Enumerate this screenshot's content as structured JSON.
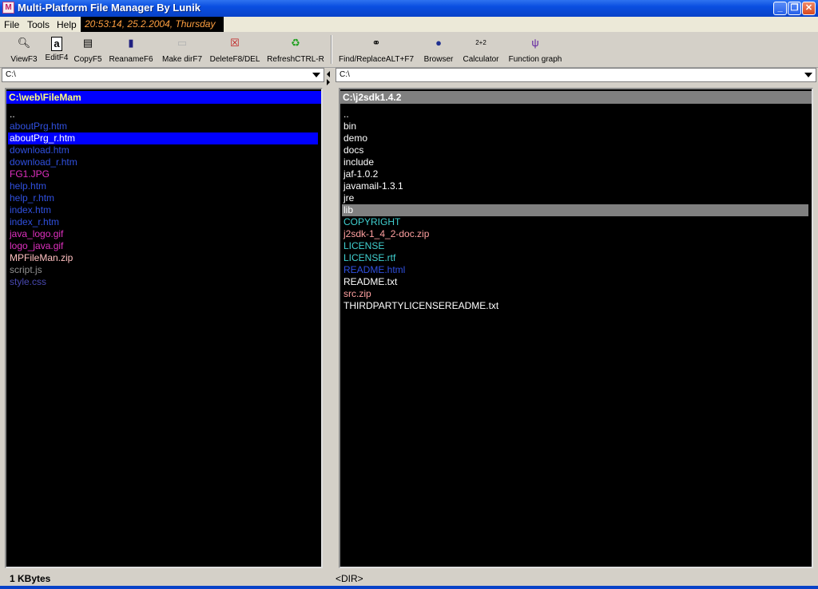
{
  "window": {
    "title": "Multi-Platform File Manager By Lunik"
  },
  "menu": {
    "file": "File",
    "tools": "Tools",
    "help": "Help"
  },
  "clock": "20:53:14, 25.2.2004, Thursday",
  "toolbar": [
    {
      "label": "ViewF3",
      "icon": "magnifier-icon"
    },
    {
      "label": "EditF4",
      "icon": "edit-icon"
    },
    {
      "label": "CopyF5",
      "icon": "copy-icon"
    },
    {
      "label": "ReanameF6",
      "icon": "rename-icon"
    },
    {
      "label": "Make dirF7",
      "icon": "folder-icon"
    },
    {
      "label": "DeleteF8/DEL",
      "icon": "delete-icon"
    },
    {
      "label": "RefreshCTRL-R",
      "icon": "refresh-icon"
    },
    {
      "label": "Find/ReplaceALT+F7",
      "icon": "binoculars-icon"
    },
    {
      "label": "Browser",
      "icon": "globe-icon"
    },
    {
      "label": "Calculator",
      "icon": "calculator-icon",
      "icon_text": "2+2"
    },
    {
      "label": "Function graph",
      "icon": "graph-icon"
    }
  ],
  "colors": {
    "dir": "#ffffff",
    "htm": "#3050e0",
    "image": "#e030c0",
    "zip": "#ffa0a0",
    "script": "#909090",
    "css": "#4040a0",
    "text_file": "#40d0d0",
    "selected_active": "#0000ff",
    "selected_inactive": "#808080"
  },
  "left": {
    "drive": "C:\\",
    "path": "C:\\web\\FileMam",
    "status": "1 KBytes",
    "files": [
      {
        "name": "..",
        "color": "#ffffff"
      },
      {
        "name": "aboutPrg.htm",
        "color": "#3050e0"
      },
      {
        "name": "aboutPrg_r.htm",
        "color": "#ffffff",
        "selected": true
      },
      {
        "name": "download.htm",
        "color": "#3050e0"
      },
      {
        "name": "download_r.htm",
        "color": "#3050e0"
      },
      {
        "name": "FG1.JPG",
        "color": "#e030c0"
      },
      {
        "name": "help.htm",
        "color": "#3050e0"
      },
      {
        "name": "help_r.htm",
        "color": "#3050e0"
      },
      {
        "name": "index.htm",
        "color": "#3050e0"
      },
      {
        "name": "index_r.htm",
        "color": "#3050e0"
      },
      {
        "name": "java_logo.gif",
        "color": "#e030c0"
      },
      {
        "name": "logo_java.gif",
        "color": "#e030c0"
      },
      {
        "name": "MPFileMan.zip",
        "color": "#ffc0c0"
      },
      {
        "name": "script.js",
        "color": "#909090"
      },
      {
        "name": "style.css",
        "color": "#4848b0"
      }
    ]
  },
  "right": {
    "drive": "C:\\",
    "path": "C:\\j2sdk1.4.2",
    "status": "<DIR>",
    "files": [
      {
        "name": "..",
        "color": "#ffffff"
      },
      {
        "name": "bin",
        "color": "#ffffff"
      },
      {
        "name": "demo",
        "color": "#ffffff"
      },
      {
        "name": "docs",
        "color": "#ffffff"
      },
      {
        "name": "include",
        "color": "#ffffff"
      },
      {
        "name": "jaf-1.0.2",
        "color": "#ffffff"
      },
      {
        "name": "javamail-1.3.1",
        "color": "#ffffff"
      },
      {
        "name": "jre",
        "color": "#ffffff"
      },
      {
        "name": "lib",
        "color": "#ffffff",
        "selected": true
      },
      {
        "name": "COPYRIGHT",
        "color": "#40d0d0"
      },
      {
        "name": "j2sdk-1_4_2-doc.zip",
        "color": "#ffa0a0"
      },
      {
        "name": "LICENSE",
        "color": "#40d0d0"
      },
      {
        "name": "LICENSE.rtf",
        "color": "#40d0d0"
      },
      {
        "name": "README.html",
        "color": "#3050e0"
      },
      {
        "name": "README.txt",
        "color": "#ffffff"
      },
      {
        "name": "src.zip",
        "color": "#ffa0a0"
      },
      {
        "name": "THIRDPARTYLICENSEREADME.txt",
        "color": "#ffffff"
      }
    ]
  }
}
